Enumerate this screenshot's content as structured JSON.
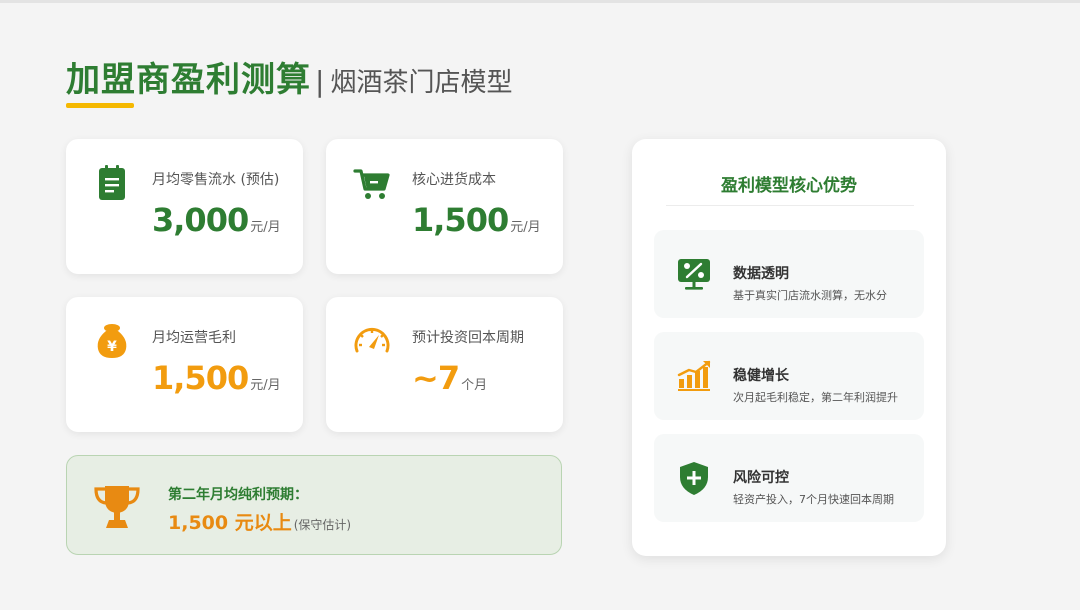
{
  "header": {
    "title_main": "加盟商盈利测算",
    "title_separator": "|",
    "title_sub": "烟酒茶门店模型"
  },
  "metrics": [
    {
      "label": "月均零售流水 (预估)",
      "value": "3,000",
      "unit": "元/月",
      "icon": "document-icon",
      "color": "#2e7d32"
    },
    {
      "label": "核心进货成本",
      "value": "1,500",
      "unit": "元/月",
      "icon": "cart-icon",
      "color": "#2e7d32"
    },
    {
      "label": "月均运营毛利",
      "value": "1,500",
      "unit": "元/月",
      "icon": "money-bag-icon",
      "color": "#f29c0f"
    },
    {
      "label": "预计投资回本周期",
      "value": "~7",
      "unit": "个月",
      "icon": "gauge-icon",
      "color": "#f29c0f"
    }
  ],
  "profit": {
    "label": "第二年月均纯利预期：",
    "value": "1,500 元以上",
    "note": "(保守估计)"
  },
  "advantages": {
    "title": "盈利模型核心优势",
    "items": [
      {
        "title": "数据透明",
        "desc": "基于真实门店流水测算，无水分",
        "icon": "percent-monitor-icon"
      },
      {
        "title": "稳健增长",
        "desc": "次月起毛利稳定，第二年利润提升",
        "icon": "growth-chart-icon"
      },
      {
        "title": "风险可控",
        "desc": "轻资产投入，7个月快速回本周期",
        "icon": "shield-plus-icon"
      }
    ]
  },
  "colors": {
    "brand_green": "#2e7d32",
    "accent_orange": "#f29c0f",
    "underline_yellow": "#f5b800"
  }
}
